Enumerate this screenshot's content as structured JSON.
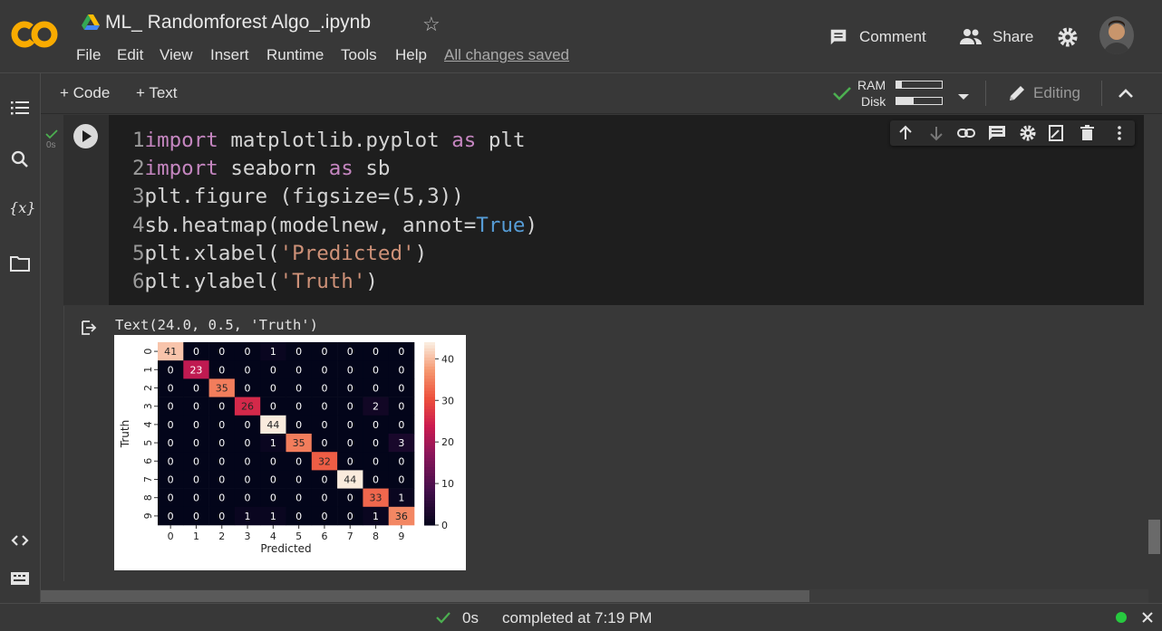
{
  "header": {
    "title": "ML_ Randomforest Algo_.ipynb",
    "saved_status": "All changes saved",
    "comment_label": "Comment",
    "share_label": "Share"
  },
  "menu": [
    "File",
    "Edit",
    "View",
    "Insert",
    "Runtime",
    "Tools",
    "Help"
  ],
  "toolbar": {
    "add_code": "+ Code",
    "add_text": "+ Text",
    "ram_label": "RAM",
    "disk_label": "Disk",
    "ram_usage": 0.12,
    "disk_usage": 0.38,
    "editing_label": "Editing"
  },
  "cell": {
    "exec_time": "0s",
    "code_lines": [
      {
        "num": "1",
        "tokens": [
          {
            "t": "import",
            "c": "kw"
          },
          {
            "t": " matplotlib.pyplot ",
            "c": ""
          },
          {
            "t": "as",
            "c": "kw"
          },
          {
            "t": " plt",
            "c": ""
          }
        ]
      },
      {
        "num": "2",
        "tokens": [
          {
            "t": "import",
            "c": "kw"
          },
          {
            "t": " seaborn ",
            "c": ""
          },
          {
            "t": "as",
            "c": "kw"
          },
          {
            "t": " sb",
            "c": ""
          }
        ]
      },
      {
        "num": "3",
        "tokens": [
          {
            "t": "plt.figure (figsize=(5,3))",
            "c": ""
          }
        ]
      },
      {
        "num": "4",
        "tokens": [
          {
            "t": "sb.heatmap(modelnew, annot=",
            "c": ""
          },
          {
            "t": "True",
            "c": "bl"
          },
          {
            "t": ")",
            "c": ""
          }
        ]
      },
      {
        "num": "5",
        "tokens": [
          {
            "t": "plt.xlabel(",
            "c": ""
          },
          {
            "t": "'Predicted'",
            "c": "str"
          },
          {
            "t": ")",
            "c": ""
          }
        ]
      },
      {
        "num": "6",
        "tokens": [
          {
            "t": "plt.ylabel(",
            "c": ""
          },
          {
            "t": "'Truth'",
            "c": "str"
          },
          {
            "t": ")",
            "c": ""
          }
        ]
      }
    ]
  },
  "output": {
    "text": "Text(24.0, 0.5, 'Truth')"
  },
  "chart_data": {
    "type": "heatmap",
    "xlabel": "Predicted",
    "ylabel": "Truth",
    "x_ticks": [
      "0",
      "1",
      "2",
      "3",
      "4",
      "5",
      "6",
      "7",
      "8",
      "9"
    ],
    "y_ticks": [
      "0",
      "1",
      "2",
      "3",
      "4",
      "5",
      "6",
      "7",
      "8",
      "9"
    ],
    "matrix": [
      [
        41,
        0,
        0,
        0,
        1,
        0,
        0,
        0,
        0,
        0
      ],
      [
        0,
        23,
        0,
        0,
        0,
        0,
        0,
        0,
        0,
        0
      ],
      [
        0,
        0,
        35,
        0,
        0,
        0,
        0,
        0,
        0,
        0
      ],
      [
        0,
        0,
        0,
        26,
        0,
        0,
        0,
        0,
        2,
        0
      ],
      [
        0,
        0,
        0,
        0,
        44,
        0,
        0,
        0,
        0,
        0
      ],
      [
        0,
        0,
        0,
        0,
        1,
        35,
        0,
        0,
        0,
        3
      ],
      [
        0,
        0,
        0,
        0,
        0,
        0,
        32,
        0,
        0,
        0
      ],
      [
        0,
        0,
        0,
        0,
        0,
        0,
        0,
        44,
        0,
        0
      ],
      [
        0,
        0,
        0,
        0,
        0,
        0,
        0,
        0,
        33,
        1
      ],
      [
        0,
        0,
        0,
        1,
        1,
        0,
        0,
        0,
        1,
        36
      ]
    ],
    "colorbar_ticks": [
      "0",
      "10",
      "20",
      "30",
      "40"
    ],
    "vmin": 0,
    "vmax": 44,
    "colormap": "rocket"
  },
  "status": {
    "time": "0s",
    "message": "completed at 7:19 PM"
  },
  "colors": {
    "background": "#383838",
    "cell_bg": "#1e1e1e",
    "accent_orange": "#f9ab00",
    "check_green": "#4caf50"
  }
}
